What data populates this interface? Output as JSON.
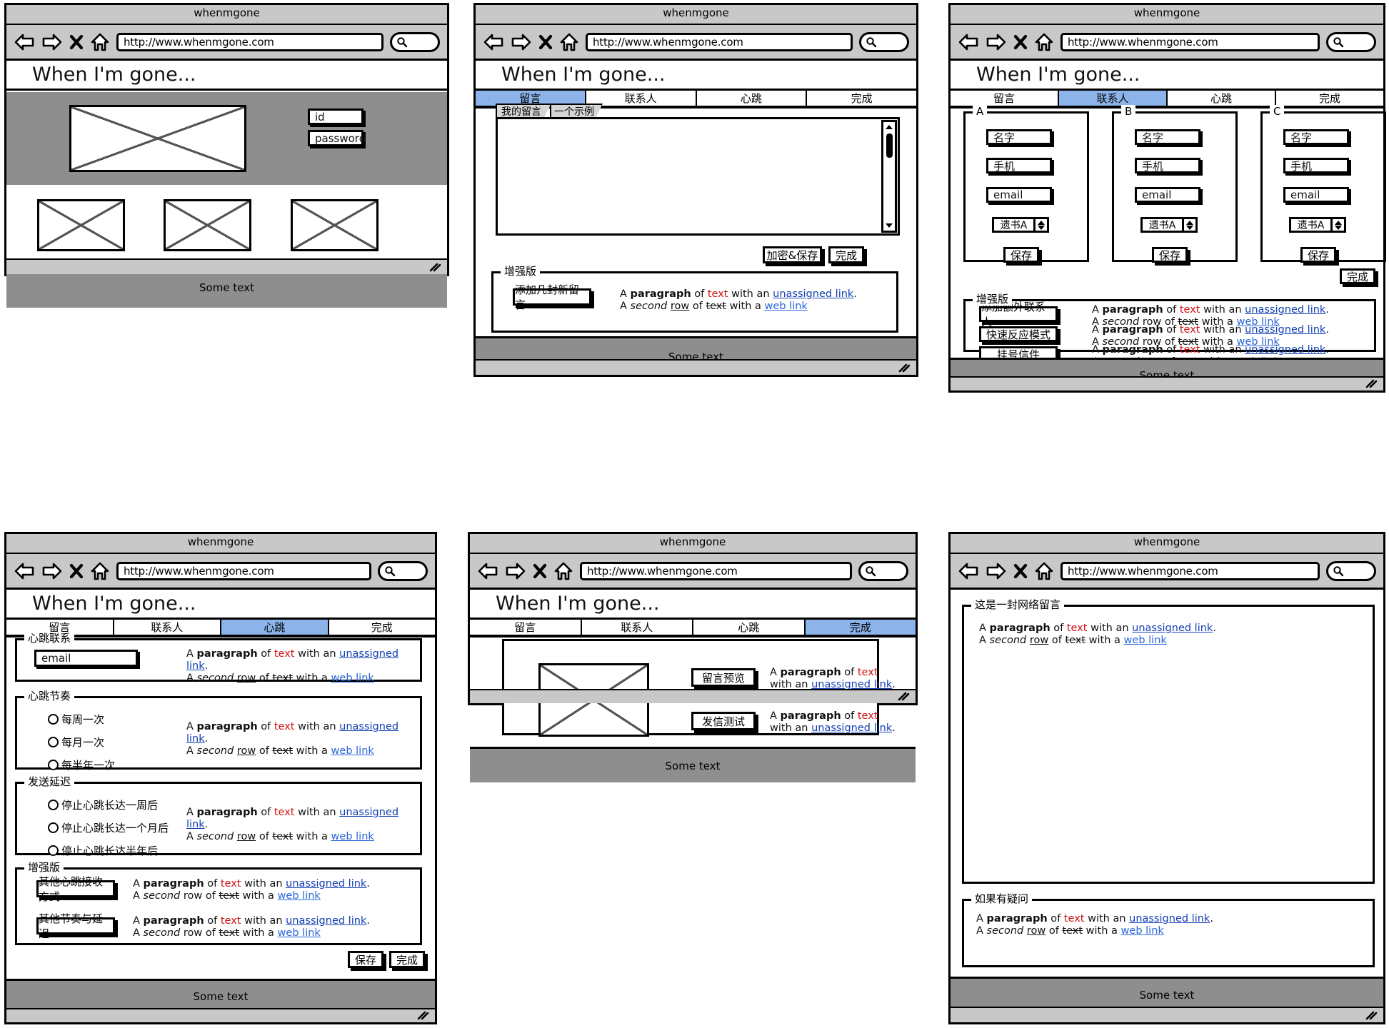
{
  "browser": {
    "title": "whenmgone",
    "url": "http://www.whenmgone.com",
    "icons": {
      "back": "back-arrow-icon",
      "forward": "forward-arrow-icon",
      "stop": "close-x-icon",
      "home": "home-icon",
      "search": "search-icon"
    }
  },
  "app": {
    "title": "When I'm gone...",
    "footer_text": "Some text"
  },
  "nav_tabs": [
    "留言",
    "联系人",
    "心跳",
    "完成"
  ],
  "paragraphs": {
    "line1": {
      "a": "A ",
      "paragraph": "paragraph",
      "b": " of ",
      "text": "text",
      "c": " with an ",
      "link": "unassigned link",
      "d": "."
    },
    "line2": {
      "a": "A ",
      "second": "second",
      "sp": " ",
      "row": "row",
      "b": " of ",
      "text": "text",
      "c": " with a ",
      "link": "web link"
    }
  },
  "panel1": {
    "login": {
      "id_placeholder": "id",
      "password_placeholder": "password"
    },
    "hero_image": "image-placeholder",
    "thumbs": [
      "image-placeholder",
      "image-placeholder",
      "image-placeholder"
    ]
  },
  "panel2": {
    "active_tab": "留言",
    "sub_tabs": [
      "我的留言",
      "一个示例"
    ],
    "active_sub_tab": "我的留言",
    "editor_value": "",
    "buttons": {
      "encrypt_save": "加密&保存",
      "done": "完成"
    },
    "premium": {
      "legend": "增强版",
      "button": "添加几封新留言"
    }
  },
  "panel3": {
    "active_tab": "联系人",
    "contacts": [
      {
        "legend": "A",
        "name_placeholder": "名字",
        "phone_placeholder": "手机",
        "email_placeholder": "email",
        "will_select": "遗书A",
        "save_button": "保存"
      },
      {
        "legend": "B",
        "name_placeholder": "名字",
        "phone_placeholder": "手机",
        "email_placeholder": "email",
        "will_select": "遗书A",
        "save_button": "保存"
      },
      {
        "legend": "C",
        "name_placeholder": "名字",
        "phone_placeholder": "手机",
        "email_placeholder": "email",
        "will_select": "遗书A",
        "save_button": "保存"
      }
    ],
    "done_button": "完成",
    "premium": {
      "legend": "增强版",
      "buttons": [
        "添加额外联系人",
        "快速反应模式",
        "挂号信件"
      ]
    }
  },
  "panel4": {
    "active_tab": "心跳",
    "contact_group": {
      "legend": "心跳联系",
      "email_placeholder": "email"
    },
    "rhythm_group": {
      "legend": "心跳节奏",
      "options": [
        "每周一次",
        "每月一次",
        "每半年一次"
      ]
    },
    "delay_group": {
      "legend": "发送延迟",
      "options": [
        "停止心跳长达一周后",
        "停止心跳长达一个月后",
        "停止心跳长达半年后"
      ]
    },
    "premium": {
      "legend": "增强版",
      "buttons": [
        "其他心跳接收方式",
        "其他节奏与延迟"
      ]
    },
    "buttons": {
      "save": "保存",
      "done": "完成"
    }
  },
  "panel5": {
    "active_tab": "完成",
    "preview_image": "image-placeholder",
    "buttons": [
      "留言预览",
      "发信测试"
    ],
    "notes": [
      {
        "a": "A ",
        "paragraph": "paragraph",
        "b": " of ",
        "text": "text",
        "c": "with an ",
        "link": "unassigned link",
        "d": "."
      },
      {
        "a": "A ",
        "paragraph": "paragraph",
        "b": " of ",
        "text": "text",
        "c": "with an ",
        "link": "unassigned link",
        "d": "."
      }
    ]
  },
  "panel6": {
    "message_group": {
      "legend": "这是一封网络留言"
    },
    "question_group": {
      "legend": "如果有疑问"
    }
  }
}
